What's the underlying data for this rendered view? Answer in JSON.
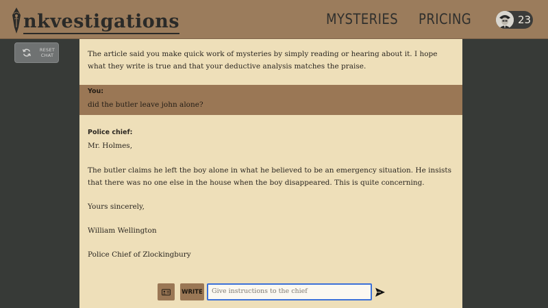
{
  "header": {
    "logo_text": "nkvestigations",
    "nav": [
      {
        "label": "MYSTERIES"
      },
      {
        "label": "PRICING"
      }
    ],
    "credits": "23"
  },
  "sidebar": {
    "reset_label": "RESET CHAT"
  },
  "chat": {
    "intro": "The article said you make quick work of mysteries by simply reading or hearing about it. I hope what they write is true and that your deductive analysis matches the praise.",
    "user_message": {
      "sender": "You:",
      "text": "did the butler leave john alone?"
    },
    "chief_message": {
      "sender": "Police chief:",
      "greeting": "Mr. Holmes,",
      "body": "The butler claims he left the boy alone in what he believed to be an emergency situation. He insists that there was no one else in the house when the boy disappeared. This is quite concerning.",
      "closing": "Yours sincerely,",
      "signature": "William Wellington",
      "title": "Police Chief of Zlockingbury"
    }
  },
  "composer": {
    "write_label": "WRITE",
    "placeholder": "Give instructions to the chief",
    "value": ""
  },
  "colors": {
    "header_bg": "#9b7c5c",
    "page_bg": "#373a37",
    "paper": "#eedfb9",
    "user_bubble": "#9a7755",
    "input_focus": "#3a6fd8"
  }
}
